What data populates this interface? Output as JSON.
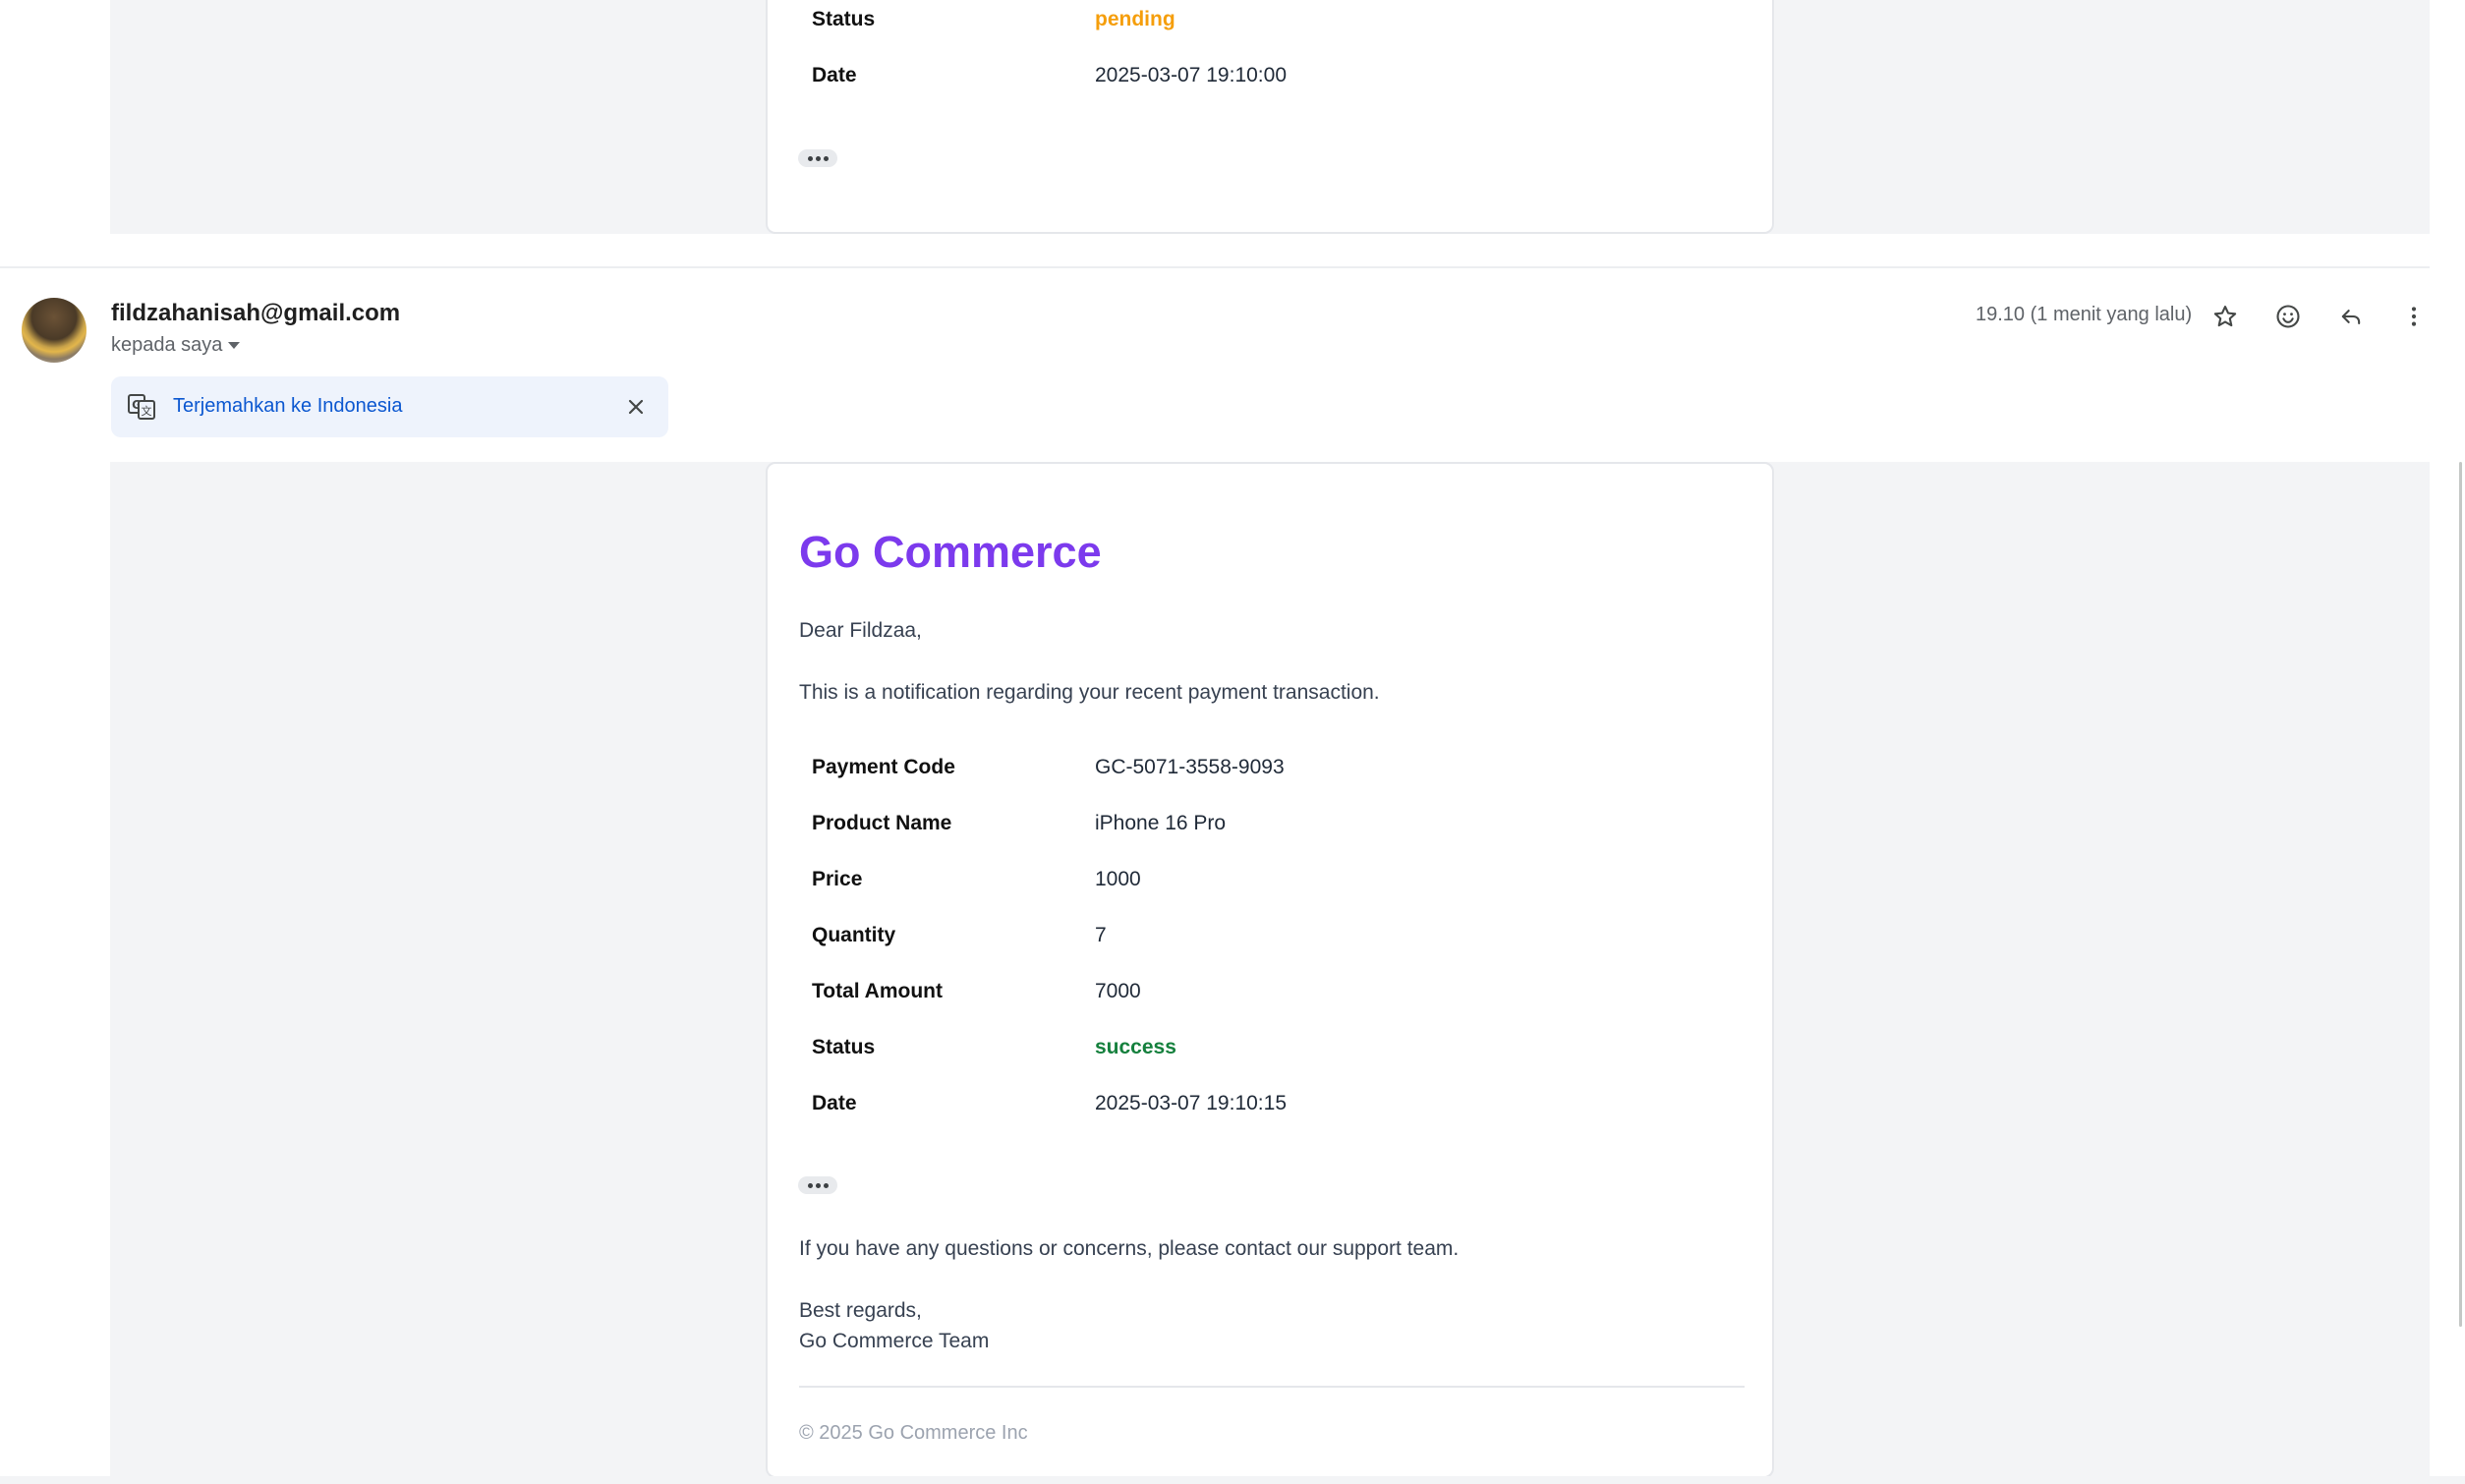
{
  "previous_message": {
    "rows": [
      {
        "label": "Status",
        "value": "pending"
      },
      {
        "label": "Date",
        "value": "2025-03-07 19:10:00"
      }
    ]
  },
  "message": {
    "sender": "fildzahanisah@gmail.com",
    "recipient": "kepada saya",
    "timestamp": "19.10 (1 menit yang lalu)",
    "icons": [
      "star-icon",
      "emoji-icon",
      "reply-icon",
      "more-vert-icon"
    ],
    "translate": {
      "link": "Terjemahkan ke Indonesia",
      "icon": "translate-icon",
      "close_icon": "close-icon"
    }
  },
  "email": {
    "brand": "Go Commerce",
    "greeting": "Dear Fildzaa,",
    "intro": "This is a notification regarding your recent payment transaction.",
    "rows": [
      {
        "label": "Payment Code",
        "value": "GC-5071-3558-9093"
      },
      {
        "label": "Product Name",
        "value": "iPhone 16 Pro"
      },
      {
        "label": "Price",
        "value": "1000"
      },
      {
        "label": "Quantity",
        "value": "7"
      },
      {
        "label": "Total Amount",
        "value": "7000"
      },
      {
        "label": "Status",
        "value": "success"
      },
      {
        "label": "Date",
        "value": "2025-03-07 19:10:15"
      }
    ],
    "support": "If you have any questions or concerns, please contact our support team.",
    "signoff": "Best regards,",
    "team": "Go Commerce Team",
    "footer": "© 2025 Go Commerce Inc"
  },
  "colors": {
    "brand": "#7c3aed",
    "pending": "#f59e0b",
    "success": "#15803d",
    "link": "#0b57d0"
  }
}
